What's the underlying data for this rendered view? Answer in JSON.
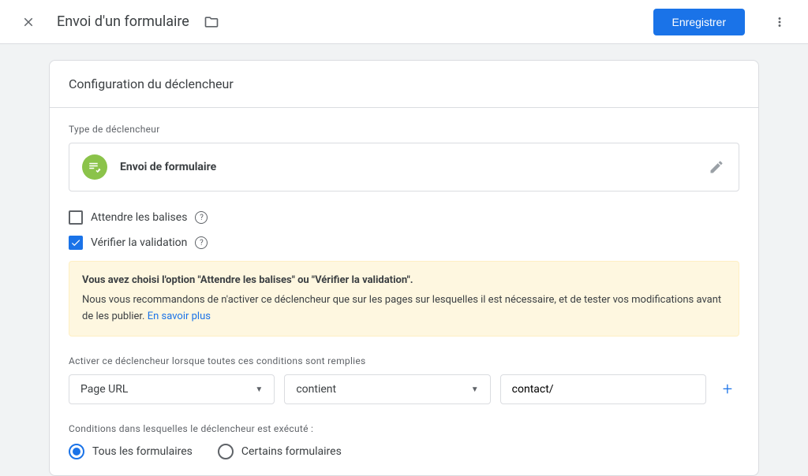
{
  "header": {
    "title": "Envoi d'un formulaire",
    "save_label": "Enregistrer"
  },
  "card": {
    "title": "Configuration du déclencheur",
    "trigger_type_label": "Type de déclencheur",
    "trigger_name": "Envoi de formulaire"
  },
  "checkboxes": {
    "wait_for_tags": {
      "label": "Attendre les balises",
      "checked": false
    },
    "check_validation": {
      "label": "Vérifier la validation",
      "checked": true
    }
  },
  "warning": {
    "bold": "Vous avez choisi l'option \"Attendre les balises\" ou \"Vérifier la validation\".",
    "text": "Nous vous recommandons de n'activer ce déclencheur que sur les pages sur lesquelles il est nécessaire, et de tester vos modifications avant de les publier.",
    "link": "En savoir plus"
  },
  "conditions": {
    "label": "Activer ce déclencheur lorsque toutes ces conditions sont remplies",
    "variable": "Page URL",
    "operator": "contient",
    "value": "contact/"
  },
  "fires_on": {
    "label": "Conditions dans lesquelles le déclencheur est exécuté :",
    "all_forms": "Tous les formulaires",
    "some_forms": "Certains formulaires",
    "selected": "all"
  }
}
